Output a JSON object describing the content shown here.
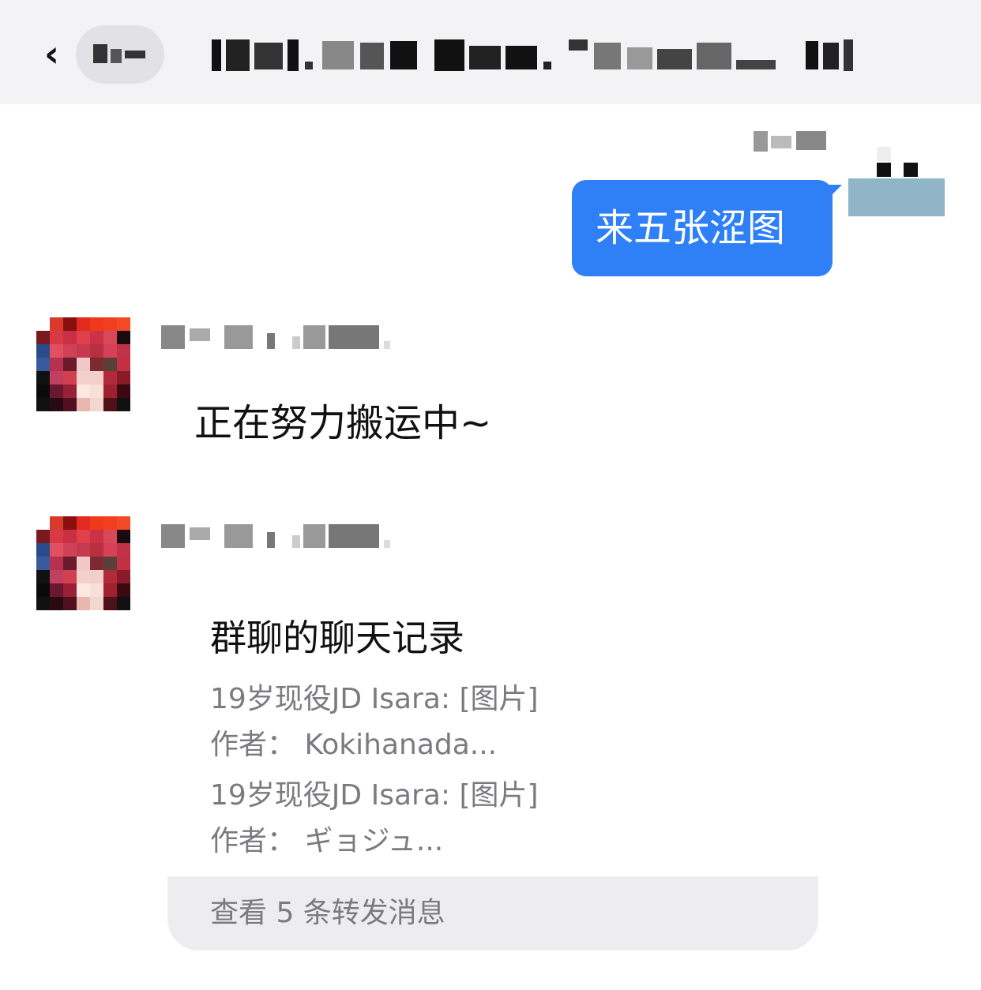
{
  "header": {
    "back_icon": "chevron-left-icon"
  },
  "messages": [
    {
      "direction": "out",
      "text": "来五张涩图"
    },
    {
      "direction": "in",
      "text": "正在努力搬运中~"
    },
    {
      "direction": "in",
      "forward_card": {
        "title": "群聊的聊天记录",
        "lines": [
          "19岁现役JD Isara: [图片]",
          "作者：  Kokihanada...",
          "19岁现役JD Isara: [图片]",
          "作者：  ギョジュ..."
        ],
        "footer": "查看 5 条转发消息"
      }
    }
  ],
  "colors": {
    "header_bg": "#f3f3f5",
    "outgoing_bubble": "#2f80f6",
    "secondary_text": "#7a7a80",
    "card_footer_bg": "#ededf0"
  }
}
